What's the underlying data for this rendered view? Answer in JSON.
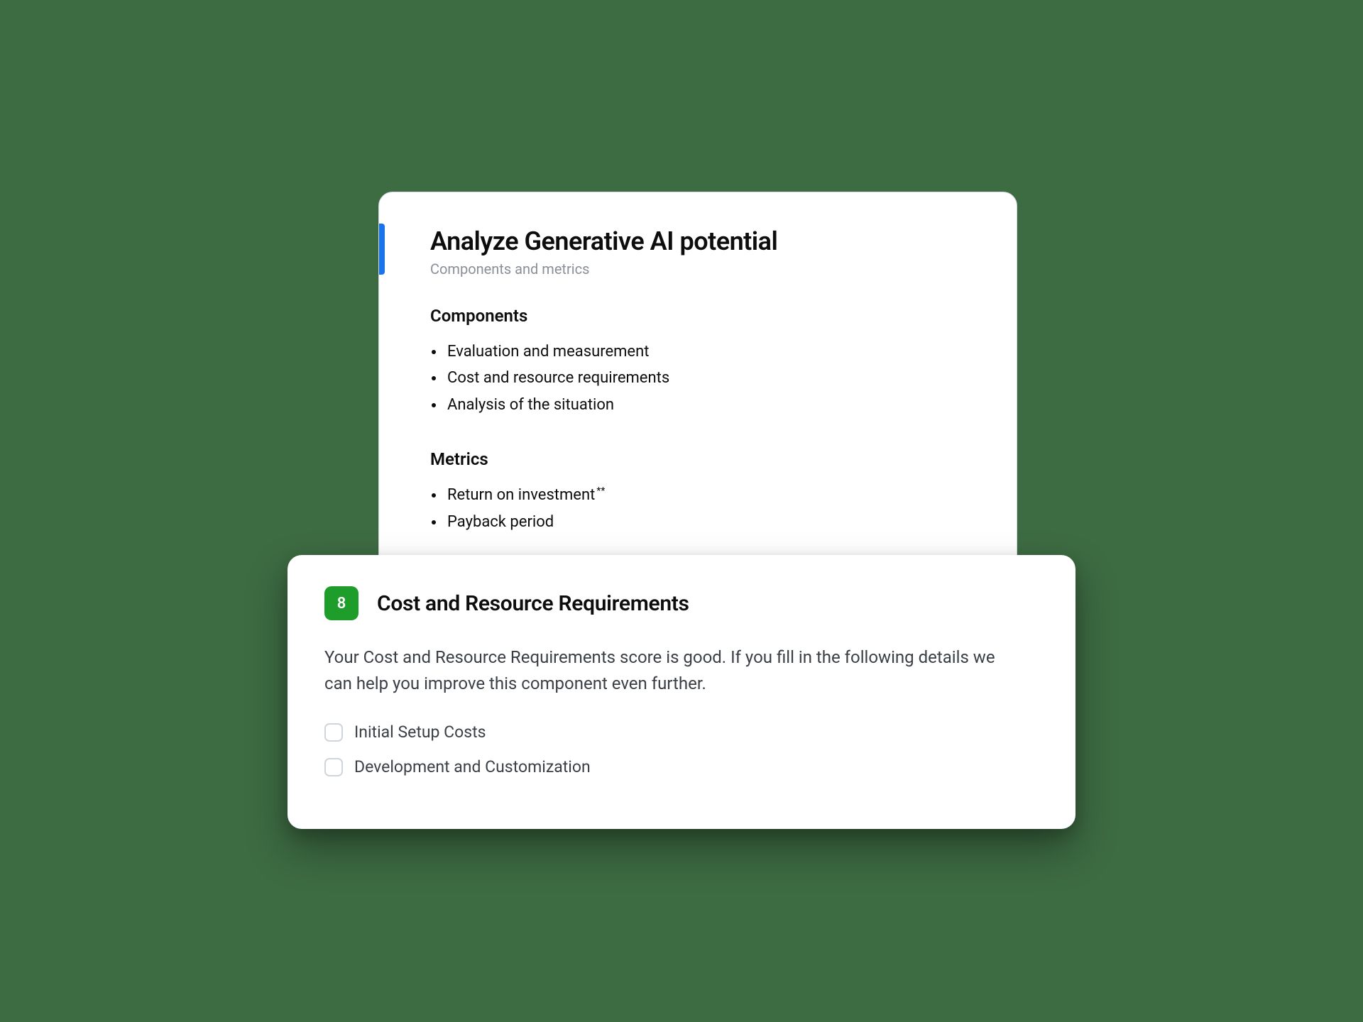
{
  "back_card": {
    "title": "Analyze Generative AI potential",
    "subtitle": "Components and metrics",
    "components_heading": "Components",
    "components": [
      "Evaluation and measurement",
      "Cost and resource requirements",
      "Analysis of the situation"
    ],
    "metrics_heading": "Metrics",
    "metrics": [
      "Return on investment",
      "Payback period"
    ],
    "metric_asterisk": "**"
  },
  "front_card": {
    "score": "8",
    "title": "Cost and Resource Requirements",
    "body": "Your Cost and Resource Requirements score is good. If you fill in the following details we can help you improve this component even further.",
    "checks": [
      "Initial Setup Costs",
      "Development and Customization"
    ]
  }
}
